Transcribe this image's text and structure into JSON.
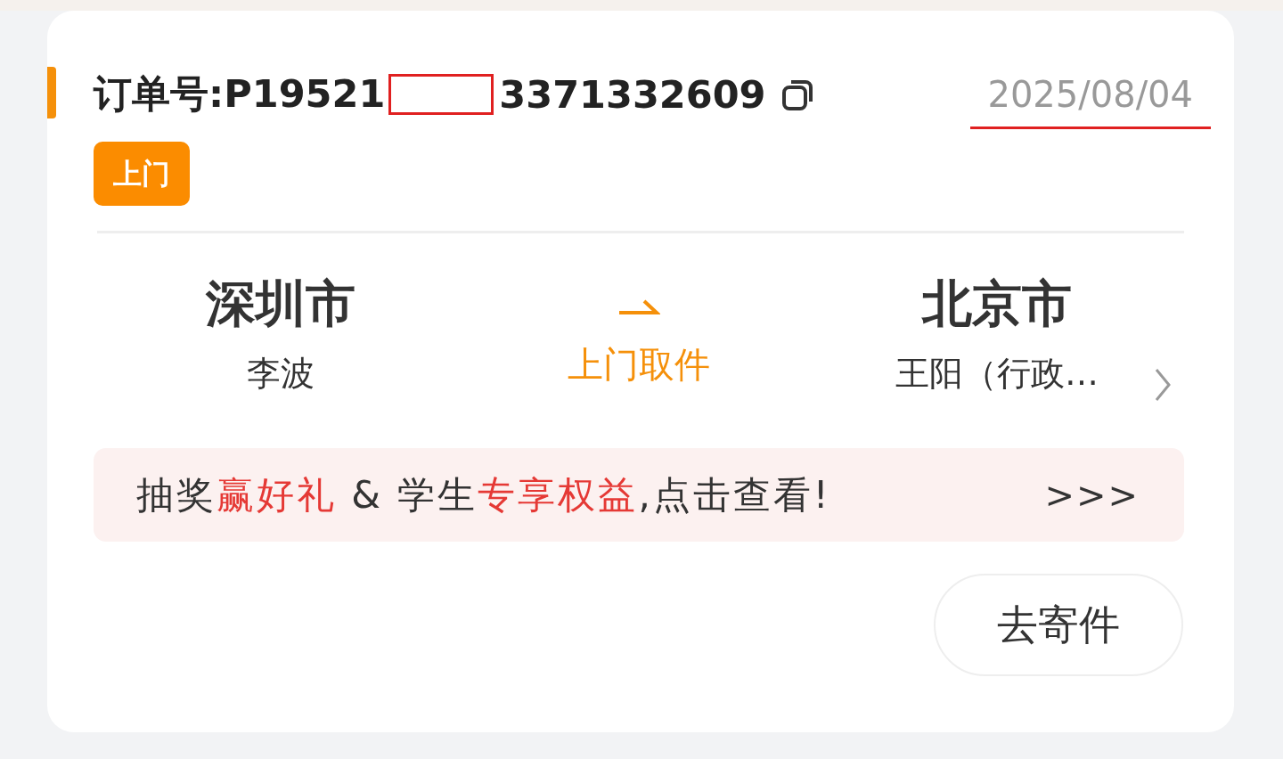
{
  "order": {
    "number_start": "订单号:P19521",
    "number_end": "3371332609",
    "date": "2025/08/04"
  },
  "tag": "上门",
  "route": {
    "from": {
      "city": "深圳市",
      "name": "李波"
    },
    "service": "上门取件",
    "to": {
      "city": "北京市",
      "name": "王阳（行政…"
    }
  },
  "banner": {
    "segments": [
      {
        "text": "抽奖",
        "highlight": false
      },
      {
        "text": "赢好礼",
        "highlight": true
      },
      {
        "text": " & 学生",
        "highlight": false
      },
      {
        "text": "专享权益",
        "highlight": true
      },
      {
        "text": ",点击查看!",
        "highlight": false
      }
    ],
    "more": ">>>"
  },
  "button": "去寄件"
}
